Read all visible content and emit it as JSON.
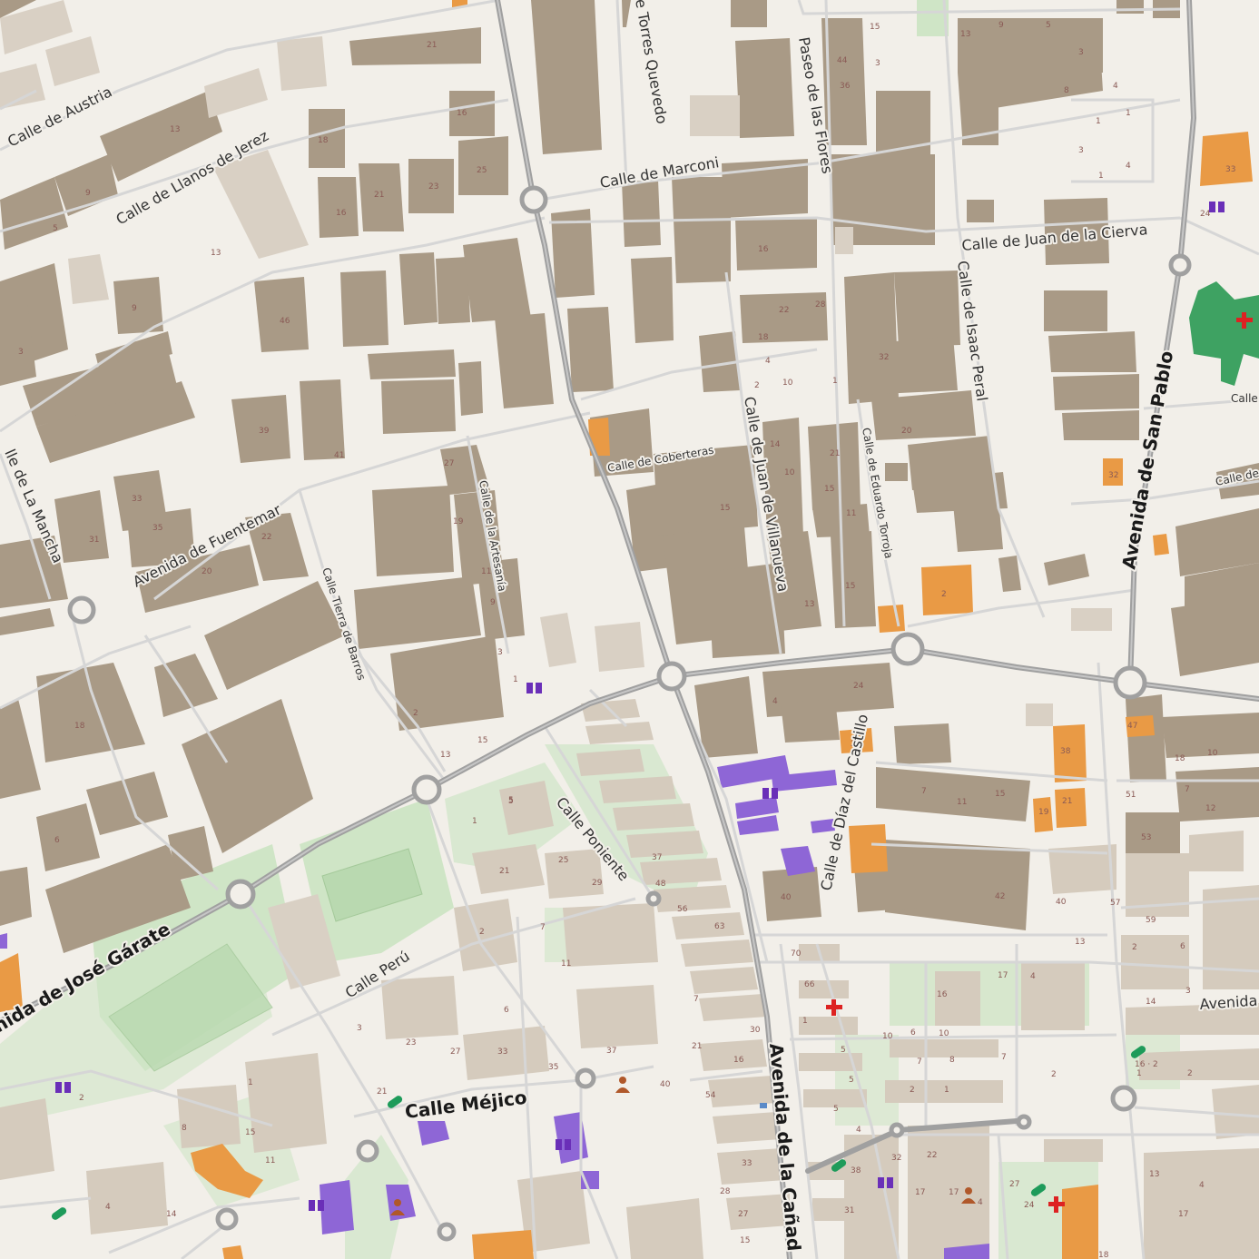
{
  "colors": {
    "background": "#f2efe9",
    "building": "#a99a86",
    "building_light": "#d9d0c4",
    "residential_block": "#d5cbbd",
    "green": "#cfe5c6",
    "pitch": "#b9d9b0",
    "hospital": "#3ea262",
    "orange_poi": "#e99a45",
    "purple_poi": "#8e66d6",
    "road_major": "#a0a0a0",
    "road_minor": "#d6d6d6"
  },
  "streets": [
    {
      "id": "austria",
      "label": "Calle de Austria"
    },
    {
      "id": "llanos",
      "label": "Calle de Llanos de Jerez"
    },
    {
      "id": "torres",
      "label": "e Torres Quevedo"
    },
    {
      "id": "flores",
      "label": "Paseo de las Flores"
    },
    {
      "id": "marconi",
      "label": "Calle de Marconi"
    },
    {
      "id": "cierva",
      "label": "Calle de Juan de la Cierva"
    },
    {
      "id": "peral",
      "label": "Calle de Isaac Peral"
    },
    {
      "id": "sanpablo",
      "label": "Avenida de San Pablo"
    },
    {
      "id": "coberteras",
      "label": "Calle de Coberteras"
    },
    {
      "id": "villanueva",
      "label": "Calle de Juan de Villanueva"
    },
    {
      "id": "torroja",
      "label": "Calle de Eduardo Torroja"
    },
    {
      "id": "artesania",
      "label": "Calle de la Artesanía"
    },
    {
      "id": "fuentemar",
      "label": "Avenida de Fuentemar"
    },
    {
      "id": "mancha",
      "label": "lle de La Mancha"
    },
    {
      "id": "tierra",
      "label": "Calle Tierra de Barros"
    },
    {
      "id": "castillo",
      "label": "Calle de Díaz del Castillo"
    },
    {
      "id": "poniente",
      "label": "Calle Poniente"
    },
    {
      "id": "garate",
      "label": "nida de José Gárate"
    },
    {
      "id": "peru",
      "label": "Calle Perú"
    },
    {
      "id": "mejico",
      "label": "Calle Méjico"
    },
    {
      "id": "canada",
      "label": "Avenida de la Cañad"
    },
    {
      "id": "calle_right1",
      "label": "Calle"
    },
    {
      "id": "calle_right2",
      "label": "Calle de"
    },
    {
      "id": "avenida_right",
      "label": "Avenida"
    }
  ],
  "house_numbers": [
    "21",
    "13",
    "9",
    "5",
    "3",
    "18",
    "16",
    "21",
    "23",
    "25",
    "16",
    "13",
    "46",
    "9",
    "39",
    "41",
    "33",
    "35",
    "31",
    "22",
    "20",
    "27",
    "19",
    "11",
    "9",
    "3",
    "1",
    "2",
    "13",
    "15",
    "5",
    "18",
    "6",
    "16",
    "22",
    "28",
    "18",
    "4",
    "2",
    "10",
    "1",
    "32",
    "20",
    "14",
    "10",
    "15",
    "21",
    "15",
    "11",
    "13",
    "15",
    "4",
    "24",
    "2",
    "7",
    "11",
    "15",
    "19",
    "40",
    "42",
    "44",
    "36",
    "15",
    "3",
    "13",
    "9",
    "5",
    "3",
    "8",
    "4",
    "1",
    "1",
    "3",
    "1",
    "4",
    "33",
    "24",
    "2",
    "32",
    "47",
    "38",
    "18",
    "10",
    "21",
    "40",
    "51",
    "53",
    "12",
    "57",
    "59",
    "14",
    "7",
    "3",
    "2",
    "6",
    "5",
    "1",
    "25",
    "21",
    "29",
    "37",
    "48",
    "56",
    "63",
    "2",
    "7",
    "11",
    "6",
    "3",
    "23",
    "27",
    "33",
    "35",
    "37",
    "40",
    "21",
    "2",
    "15",
    "11",
    "1",
    "21",
    "16",
    "7",
    "30",
    "33",
    "54",
    "28",
    "27",
    "15",
    "70",
    "66",
    "1",
    "5",
    "5",
    "5",
    "4",
    "10",
    "6",
    "10",
    "16",
    "17",
    "4",
    "13",
    "7",
    "7",
    "8",
    "1",
    "2",
    "2",
    "22",
    "32",
    "38",
    "31",
    "17",
    "17",
    "4",
    "27",
    "24",
    "13",
    "4",
    "17",
    "18",
    "1",
    "16 · 2",
    "2",
    "8",
    "4",
    "14"
  ]
}
